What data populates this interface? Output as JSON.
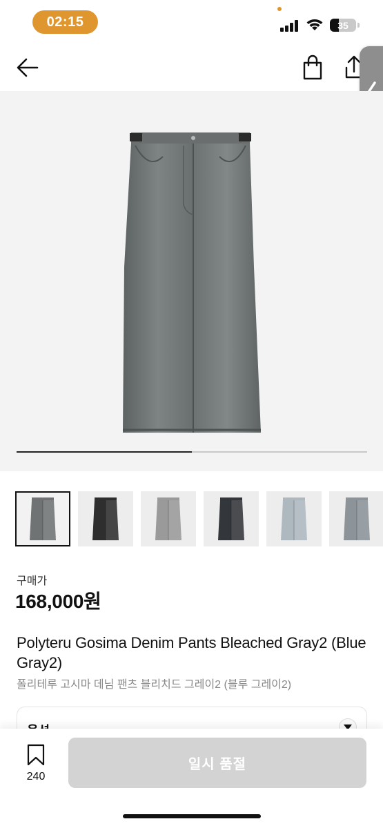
{
  "status_bar": {
    "time": "02:15",
    "battery": "35",
    "battery_level": 0.35
  },
  "nav": {
    "back_icon": "arrow-left-icon",
    "bag_icon": "shopping-bag-icon",
    "share_icon": "share-icon",
    "side_handle_icon": "chevron-left-icon"
  },
  "product": {
    "image_index_progress": 0.5,
    "thumbnails": [
      {
        "name": "thumb-gray",
        "color": "#6f7374",
        "selected": true
      },
      {
        "name": "thumb-black",
        "color": "#2e2e2e",
        "selected": false
      },
      {
        "name": "thumb-bleached-gray",
        "color": "#9a9a9a",
        "selected": false
      },
      {
        "name": "thumb-dark-black",
        "color": "#33363a",
        "selected": false
      },
      {
        "name": "thumb-light-blue",
        "color": "#aeb8bf",
        "selected": false
      },
      {
        "name": "thumb-blue-gray",
        "color": "#8c949a",
        "selected": false
      }
    ],
    "price_label": "구매가",
    "price": "168,000원",
    "title_en": "Polyteru Gosima Denim Pants Bleached Gray2 (Blue Gray2)",
    "title_ko": "폴리테루 고시마 데님 팬츠 블리치드 그레이2 (블루 그레이2)",
    "option_label": "옵션"
  },
  "bottom_bar": {
    "bookmark_count": "240",
    "action_label": "일시 품절"
  },
  "colors": {
    "accent": "#e0962f",
    "disabled_button": "#d3d3d3"
  }
}
